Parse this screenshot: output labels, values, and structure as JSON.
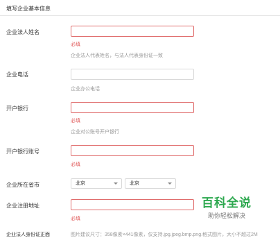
{
  "section": {
    "title": "填写企业基本信息"
  },
  "fields": {
    "legal_name": {
      "label": "企业法人姓名",
      "value": "",
      "required": "必填",
      "hint": "企业法人代表姓名，与法人代表身份证一致"
    },
    "phone": {
      "label": "企业电话",
      "value": "",
      "hint": "企业办公电话"
    },
    "bank": {
      "label": "开户银行",
      "value": "",
      "required": "必填",
      "hint": "企业对公账号开户银行"
    },
    "account": {
      "label": "开户银行账号",
      "value": "",
      "required": "必填"
    },
    "region": {
      "label": "企业所在省市",
      "province": "北京",
      "city": "北京"
    },
    "address": {
      "label": "企业注册地址",
      "value": "",
      "required": "必填"
    },
    "upload": {
      "label": "企业法人身份证正面",
      "hint": "图片建议尺寸：358像素×441像素，仅支持.jpg.jpeg.bmp.png.格式图片，大小不超过2M"
    }
  },
  "watermark": {
    "title": "百科全说",
    "subtitle": "助你轻松解决"
  },
  "colors": {
    "error_border": "#e06c6c",
    "required_text": "#e05a5a",
    "hint_text": "#999999",
    "watermark_green": "#2da84f"
  }
}
